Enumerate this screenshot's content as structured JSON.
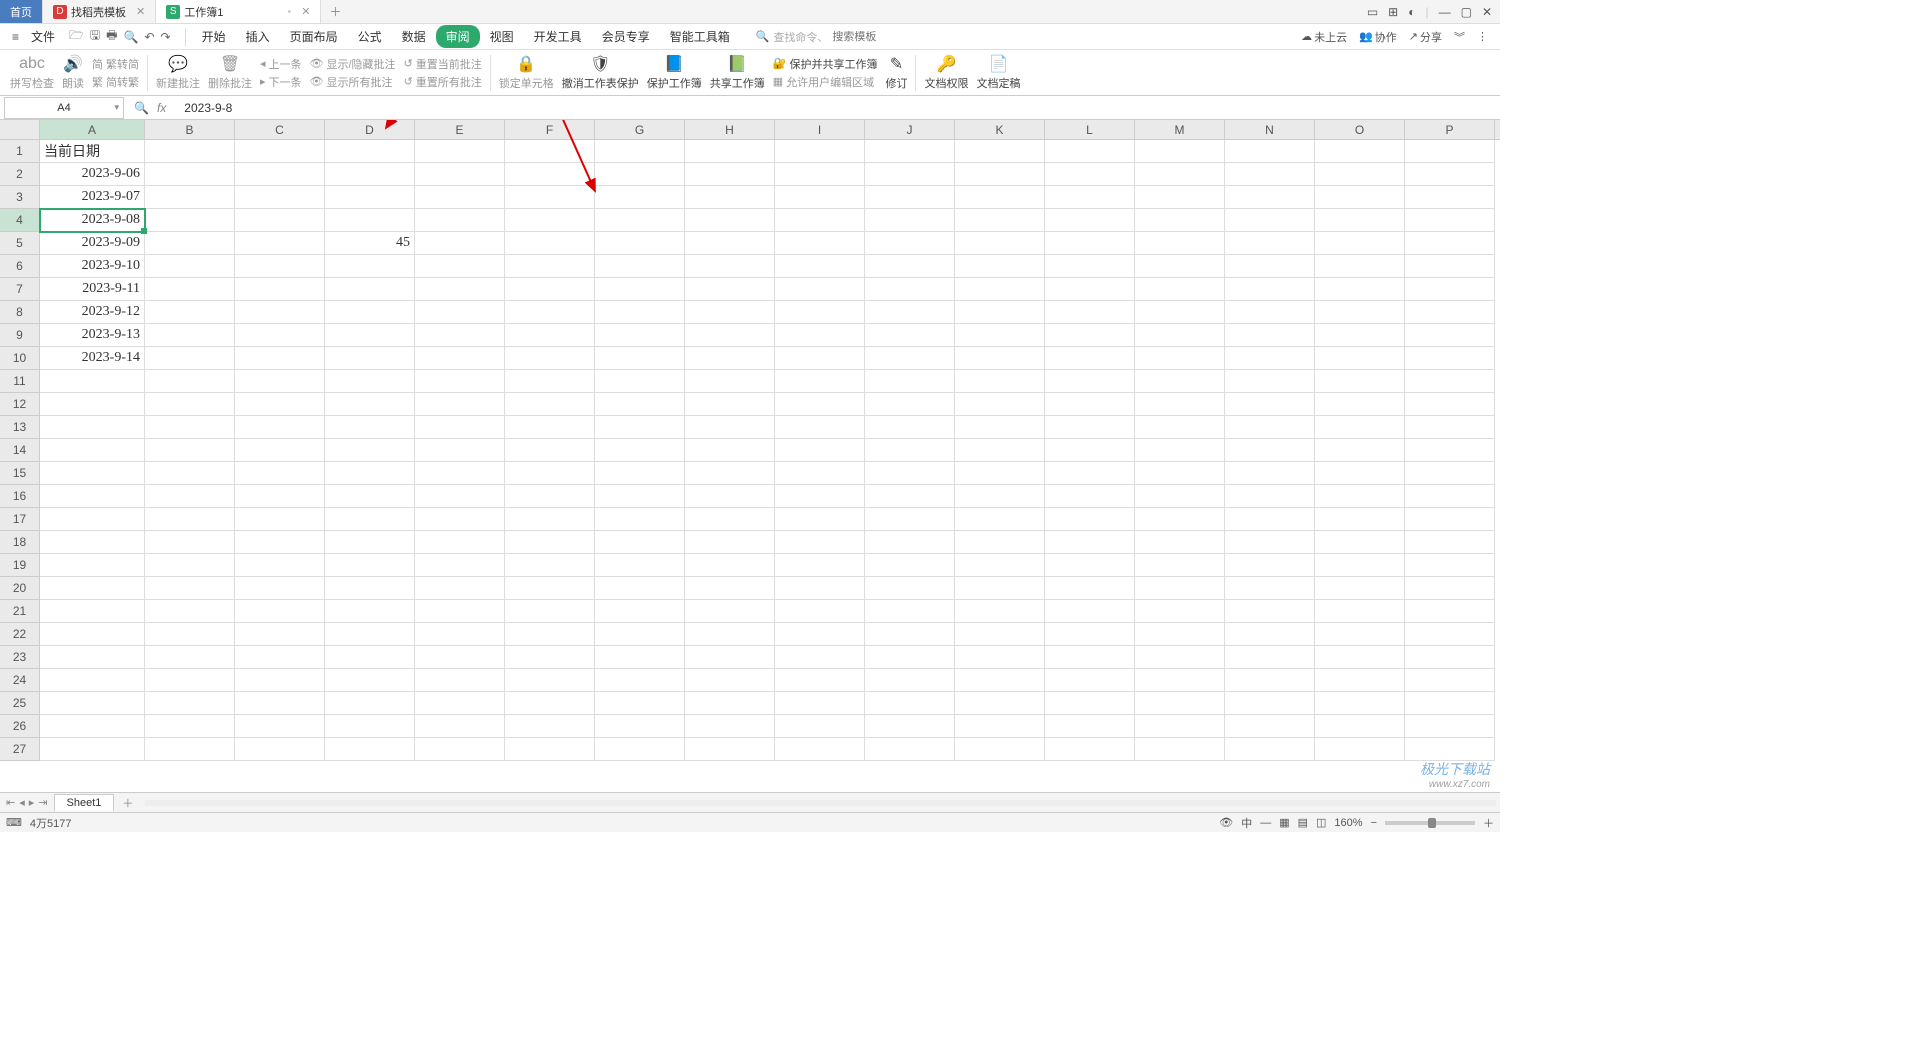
{
  "tabs": {
    "home": "首页",
    "template": "找稻壳模板",
    "workbook": "工作簿1"
  },
  "menurow": {
    "file": "文件",
    "items": [
      "开始",
      "插入",
      "页面布局",
      "公式",
      "数据",
      "审阅",
      "视图",
      "开发工具",
      "会员专享",
      "智能工具箱"
    ],
    "active_index": 5,
    "search_hint1": "查找命令、",
    "search_placeholder": "搜索模板"
  },
  "right_tools": {
    "cloud": "未上云",
    "coop": "协作",
    "share": "分享"
  },
  "ribbon": {
    "spellcheck": "拼写检查",
    "read_aloud": "朗读",
    "trad_simp_top": "繁转简",
    "trad_simp_bot": "简转繁",
    "new_comment": "新建批注",
    "delete_comment": "删除批注",
    "prev": "上一条",
    "next": "下一条",
    "show_hide_comment": "显示/隐藏批注",
    "show_all_comments": "显示所有批注",
    "reset_current": "重置当前批注",
    "reset_all": "重置所有批注",
    "lock_cell": "锁定单元格",
    "unprotect_sheet": "撤消工作表保护",
    "protect_workbook": "保护工作簿",
    "share_workbook": "共享工作簿",
    "protect_share_workbook": "保护并共享工作簿",
    "allow_edit_ranges": "允许用户编辑区域",
    "track_changes": "修订",
    "doc_perm": "文档权限",
    "doc_final": "文档定稿"
  },
  "formula_bar": {
    "name": "A4",
    "value": "2023-9-8"
  },
  "columns": [
    "A",
    "B",
    "C",
    "D",
    "E",
    "F",
    "G",
    "H",
    "I",
    "J",
    "K",
    "L",
    "M",
    "N",
    "O",
    "P"
  ],
  "rows_count": 27,
  "selected": {
    "col": "A",
    "row": 4
  },
  "cells": {
    "A1": "当前日期",
    "A2": "2023-9-06",
    "A3": "2023-9-07",
    "A4": "2023-9-08",
    "A5": "2023-9-09",
    "A6": "2023-9-10",
    "A7": "2023-9-11",
    "A8": "2023-9-12",
    "A9": "2023-9-13",
    "A10": "2023-9-14",
    "D5": "45"
  },
  "sheet": {
    "name": "Sheet1"
  },
  "status": {
    "record": "4万5177",
    "zoom": "160%"
  },
  "watermark": {
    "brand": "极光下载站",
    "url": "www.xz7.com"
  }
}
